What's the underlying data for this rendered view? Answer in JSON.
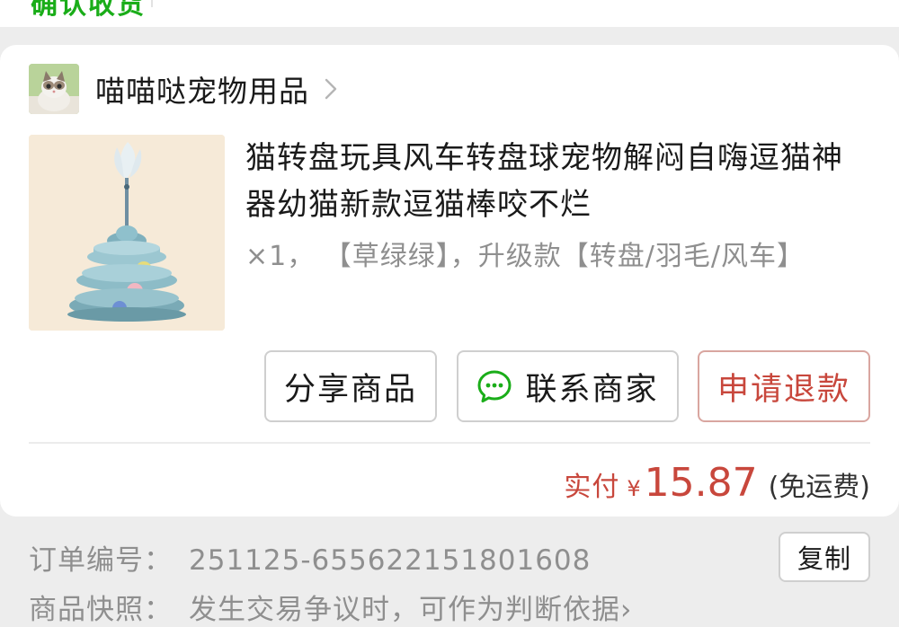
{
  "top": {
    "cut_text": "确认收货"
  },
  "shop": {
    "name": "喵喵哒宠物用品",
    "avatar_icon": "cat-avatar",
    "chevron_icon": "chevron-right-icon"
  },
  "product": {
    "title": "猫转盘玩具风车转盘球宠物解闷自嗨逗猫神器幼猫新款逗猫棒咬不烂",
    "spec": "×1， 【草绿绿】，升级款【转盘/羽毛/风车】",
    "image_icon": "cat-turntable-toy-image"
  },
  "actions": {
    "share_label": "分享商品",
    "contact_label": "联系商家",
    "refund_label": "申请退款",
    "contact_icon": "wechat-chat-icon"
  },
  "payment": {
    "label": "实付",
    "currency": "¥",
    "amount": "15.87",
    "note": "(免运费)"
  },
  "order_info": {
    "order_number_label": "订单编号：",
    "order_number_value": "251125-655622151801608",
    "copy_label": "复制",
    "snapshot_label": "商品快照：",
    "snapshot_value": "发生交易争议时，可作为判断依据",
    "snapshot_chevron": "›"
  },
  "colors": {
    "accent_red": "#c8473c",
    "wechat_green": "#1aad19",
    "muted_text": "#8f8f8f"
  }
}
